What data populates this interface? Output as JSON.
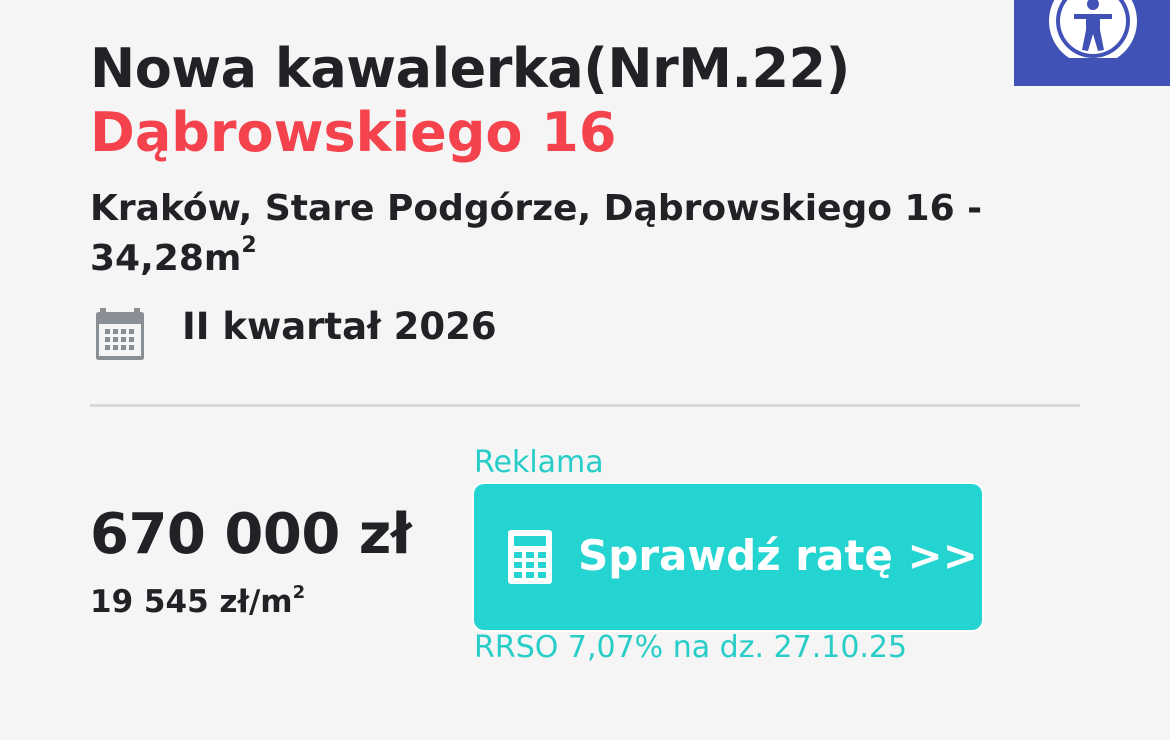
{
  "header": {
    "title": "Nowa kawalerka(NrM.22)",
    "subtitle": "Dąbrowskiego 16",
    "address": "Kraków, Stare Podgórze, Dąbrowskiego 16 - 34,28m",
    "area_sup": "2"
  },
  "delivery": {
    "icon": "calendar-icon",
    "text": "II kwartał 2026"
  },
  "price": {
    "total": "670 000 zł",
    "per_m2": "19 545 zł/m",
    "per_m2_sup": "2"
  },
  "ad": {
    "label": "Reklama",
    "button_icon": "calculator-icon",
    "button_label": "Sprawdź ratę >>",
    "rrso": "RRSO 7,07% na dz. 27.10.25"
  },
  "accessibility": {
    "icon": "accessibility-icon"
  },
  "colors": {
    "accent_red": "#f5434d",
    "accent_teal": "#24d4d0",
    "a11y_blue": "#4052b5"
  }
}
